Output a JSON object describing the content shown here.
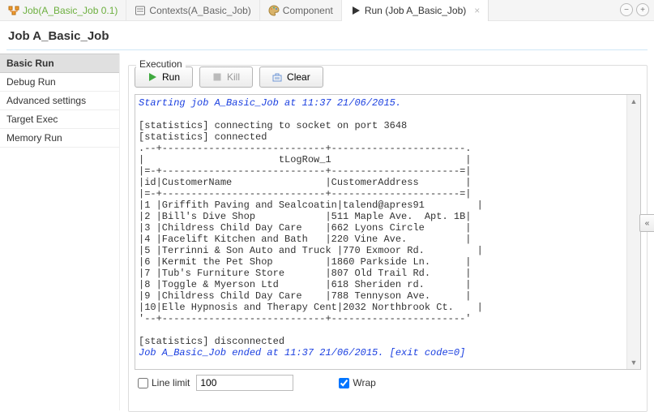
{
  "tabs": [
    {
      "label": "Job(A_Basic_Job 0.1)",
      "icon": "job"
    },
    {
      "label": "Contexts(A_Basic_Job)",
      "icon": "contexts"
    },
    {
      "label": "Component",
      "icon": "palette"
    },
    {
      "label": "Run (Job A_Basic_Job)",
      "icon": "run",
      "active": true
    }
  ],
  "header": {
    "title": "Job A_Basic_Job"
  },
  "sidebar": {
    "items": [
      "Basic Run",
      "Debug Run",
      "Advanced settings",
      "Target Exec",
      "Memory Run"
    ],
    "selected": 0
  },
  "group": {
    "title": "Execution"
  },
  "buttons": {
    "run": "Run",
    "kill": "Kill",
    "clear": "Clear"
  },
  "console": {
    "start": "Starting job A_Basic_Job at 11:37 21/06/2015.",
    "end": "Job A_Basic_Job ended at 11:37 21/06/2015. [exit code=0]",
    "lines": [
      "",
      "[statistics] connecting to socket on port 3648",
      "[statistics] connected",
      ".--+----------------------------+-----------------------.",
      "|                       tLogRow_1                       |",
      "|=-+----------------------------+----------------------=|",
      "|id|CustomerName                |CustomerAddress        |",
      "|=-+----------------------------+----------------------=|",
      "|1 |Griffith Paving and Sealcoatin|talend@apres91         |",
      "|2 |Bill's Dive Shop            |511 Maple Ave.  Apt. 1B|",
      "|3 |Childress Child Day Care    |662 Lyons Circle       |",
      "|4 |Facelift Kitchen and Bath   |220 Vine Ave.          |",
      "|5 |Terrinni & Son Auto and Truck |770 Exmoor Rd.         |",
      "|6 |Kermit the Pet Shop         |1860 Parkside Ln.      |",
      "|7 |Tub's Furniture Store       |807 Old Trail Rd.      |",
      "|8 |Toggle & Myerson Ltd        |618 Sheriden rd.       |",
      "|9 |Childress Child Day Care    |788 Tennyson Ave.      |",
      "|10|Elle Hypnosis and Therapy Cent|2032 Northbrook Ct.    |",
      "'--+----------------------------+-----------------------'",
      "",
      "[statistics] disconnected"
    ]
  },
  "footer": {
    "lineLimitLabel": "Line limit",
    "lineLimitValue": "100",
    "lineLimitChecked": false,
    "wrapLabel": "Wrap",
    "wrapChecked": true
  },
  "glyphs": {
    "minus": "−",
    "plus": "+",
    "doubleLeft": "«",
    "up": "▲",
    "down": "▼"
  }
}
